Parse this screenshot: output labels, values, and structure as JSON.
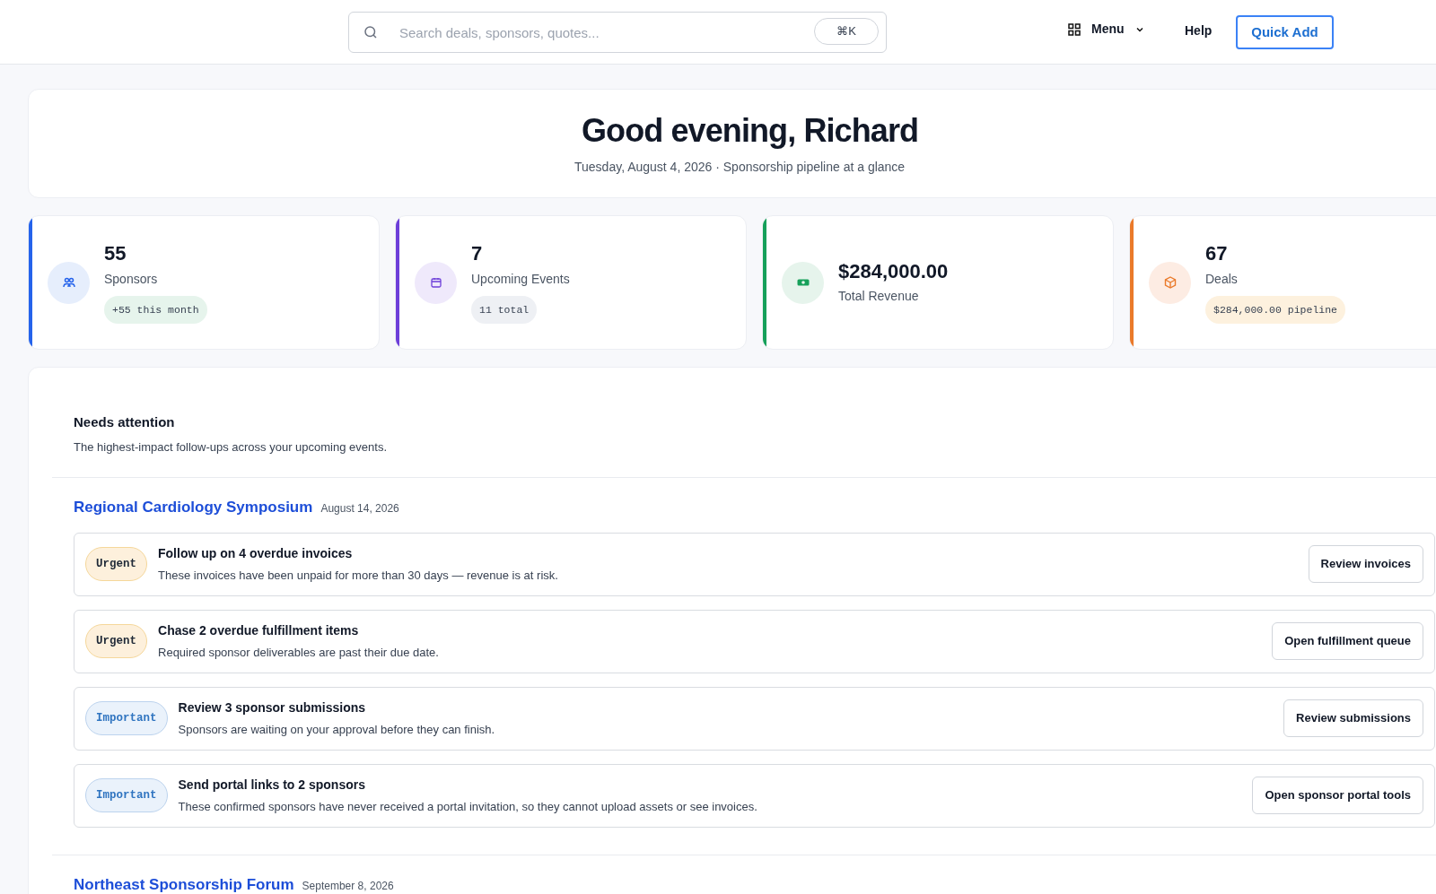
{
  "header": {
    "search": {
      "placeholder": "Search deals, sponsors, quotes...",
      "shortcut": "⌘K"
    },
    "menu": "Menu",
    "help": "Help",
    "quick_add": "Quick Add"
  },
  "greeting": {
    "title": "Good evening, Richard",
    "subtitle": "Tuesday, August 4, 2026 · Sponsorship pipeline at a glance"
  },
  "stats": [
    {
      "kind": "sponsors",
      "value": "55",
      "label": "Sponsors",
      "badge": "+55 this month"
    },
    {
      "kind": "events",
      "value": "7",
      "label": "Upcoming Events",
      "badge": "11 total"
    },
    {
      "kind": "revenue",
      "value": "$284,000.00",
      "label": "Total Revenue"
    },
    {
      "kind": "deals",
      "value": "67",
      "label": "Deals",
      "badge": "$284,000.00 pipeline"
    }
  ],
  "attention": {
    "title": "Needs attention",
    "subtitle": "The highest-impact follow-ups across your upcoming events.",
    "events": [
      {
        "name": "Regional Cardiology Symposium",
        "date": "August 14, 2026",
        "items": [
          {
            "kind": "urgent",
            "badge": "Urgent",
            "title": "Follow up on 4 overdue invoices",
            "description": "These invoices have been unpaid for more than 30 days — revenue is at risk.",
            "action": "Review invoices"
          },
          {
            "kind": "urgent",
            "badge": "Urgent",
            "title": "Chase 2 overdue fulfillment items",
            "description": "Required sponsor deliverables are past their due date.",
            "action": "Open fulfillment queue"
          },
          {
            "kind": "important",
            "badge": "Important",
            "title": "Review 3 sponsor submissions",
            "description": "Sponsors are waiting on your approval before they can finish.",
            "action": "Review submissions"
          },
          {
            "kind": "important",
            "badge": "Important",
            "title": "Send portal links to 2 sponsors",
            "description": "These confirmed sponsors have never received a portal invitation, so they cannot upload assets or see invoices.",
            "action": "Open sponsor portal tools"
          }
        ]
      },
      {
        "name": "Northeast Sponsorship Forum",
        "date": "September 8, 2026"
      }
    ]
  }
}
